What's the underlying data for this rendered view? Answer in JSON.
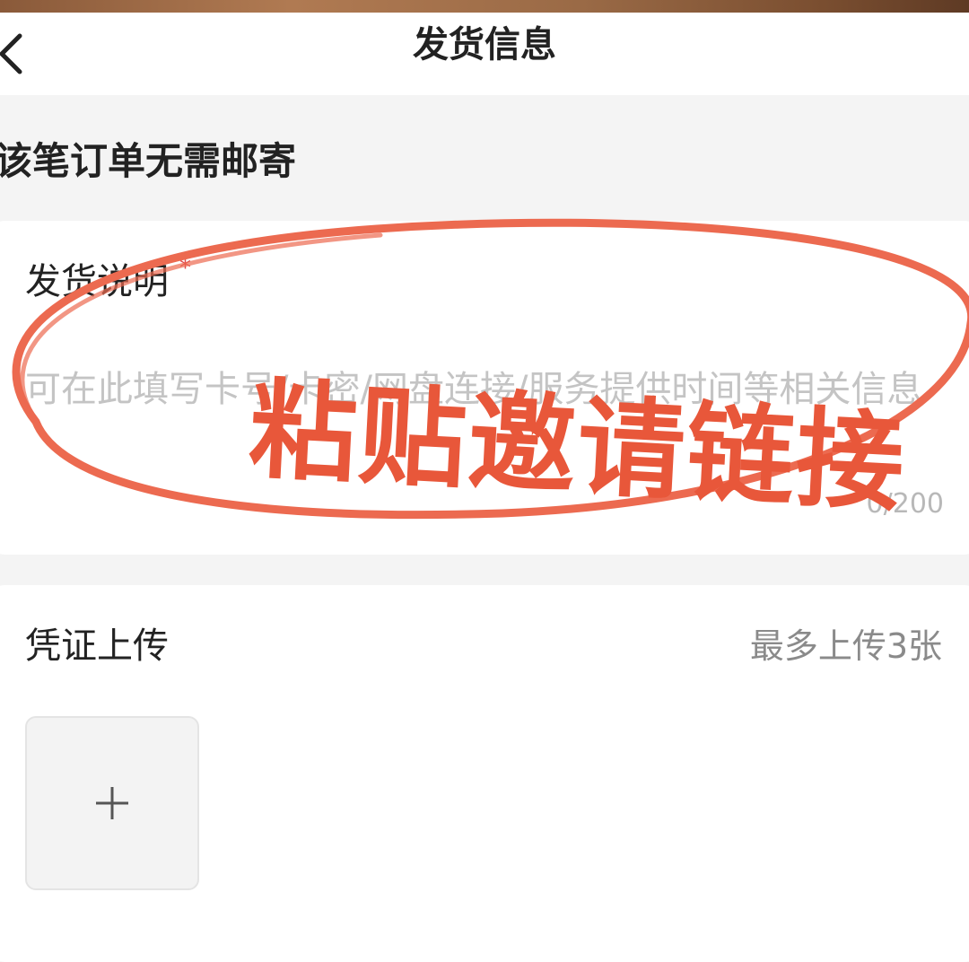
{
  "header": {
    "title": "发货信息",
    "back_icon": "chevron-left-icon"
  },
  "notice": "该笔订单无需邮寄",
  "shipping_description": {
    "label": "发货说明",
    "required_mark": "*",
    "placeholder": "可在此填写卡号/卡密/网盘连接/服务提供时间等相关信息",
    "value": "",
    "char_count": "0/200"
  },
  "proof_upload": {
    "title": "凭证上传",
    "limit": "最多上传3张",
    "add_icon": "plus-icon"
  },
  "annotation": {
    "text": "粘贴邀请链接",
    "color": "#e8573a"
  },
  "colors": {
    "required": "#e0454a",
    "annotation": "#e8573a",
    "background": "#f4f4f4"
  }
}
